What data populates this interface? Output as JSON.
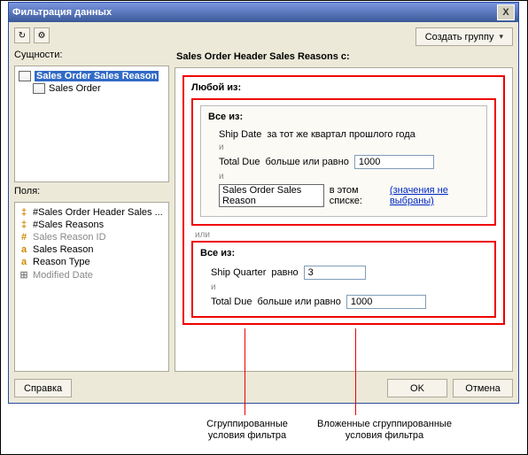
{
  "window": {
    "title": "Фильтрация данных",
    "close_glyph": "X"
  },
  "toolbar": {
    "create_group": "Создать группу",
    "icon1": "↻",
    "icon2": "⚙"
  },
  "entities": {
    "label": "Сущности:",
    "root": "Sales Order Sales Reason",
    "child": "Sales Order"
  },
  "fields": {
    "label": "Поля:",
    "items": [
      {
        "glyph": "‡",
        "cls": "k",
        "text": "#Sales Order Header Sales ..."
      },
      {
        "glyph": "‡",
        "cls": "k",
        "text": "#Sales Reasons"
      },
      {
        "glyph": "#",
        "cls": "n grey",
        "text": "Sales Reason ID",
        "grey": true
      },
      {
        "glyph": "a",
        "cls": "a",
        "text": "Sales Reason"
      },
      {
        "glyph": "a",
        "cls": "a",
        "text": "Reason Type"
      },
      {
        "glyph": "⊞",
        "cls": "d grey",
        "text": "Modified Date",
        "grey": true
      }
    ]
  },
  "conditions": {
    "header": "Sales Order Header Sales Reasons с:",
    "any_of": "Любой из:",
    "all_of": "Все из:",
    "or": "или",
    "and": "и",
    "g1": {
      "l1_field": "Ship Date",
      "l1_op": "за тот же квартал прошлого года",
      "l2_field": "Total Due",
      "l2_op": "больше или равно",
      "l2_val": "1000",
      "l3_field": "Sales Order Sales Reason",
      "l3_op": "в этом списке:",
      "l3_val": "(значения не выбраны)"
    },
    "g2": {
      "l1_field": "Ship Quarter",
      "l1_op": "равно",
      "l1_val": "3",
      "l2_field": "Total Due",
      "l2_op": "больше или равно",
      "l2_val": "1000"
    }
  },
  "buttons": {
    "help": "Справка",
    "ok": "OK",
    "cancel": "Отмена"
  },
  "callouts": {
    "left": "Сгруппированные\nусловия фильтра",
    "right": "Вложенные сгруппированные\nусловия фильтра"
  }
}
